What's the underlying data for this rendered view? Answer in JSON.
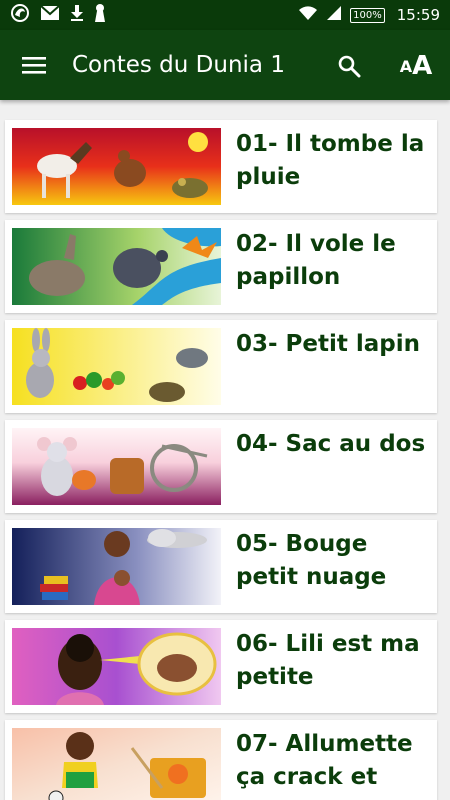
{
  "status_bar": {
    "time": "15:59",
    "battery": "100%",
    "icons": [
      "app-icon",
      "gmail-icon",
      "download-icon",
      "keyhole-icon",
      "wifi-icon",
      "signal-icon",
      "battery-icon"
    ]
  },
  "app_bar": {
    "title": "Contes du Dunia 1",
    "font_small": "A",
    "font_big": "A",
    "color": "#0e4410"
  },
  "stories": [
    {
      "title": "01- Il tombe la pluie"
    },
    {
      "title": "02- Il vole le papillon"
    },
    {
      "title": "03- Petit lapin"
    },
    {
      "title": "04- Sac au dos"
    },
    {
      "title": "05- Bouge petit nuage"
    },
    {
      "title": "06- Lili est ma petite"
    },
    {
      "title": "07- Allumette ça crack et"
    }
  ],
  "colors": {
    "title_text": "#0b3d0b",
    "background": "#f0f0f0",
    "status_bar": "#0a3a0a"
  }
}
